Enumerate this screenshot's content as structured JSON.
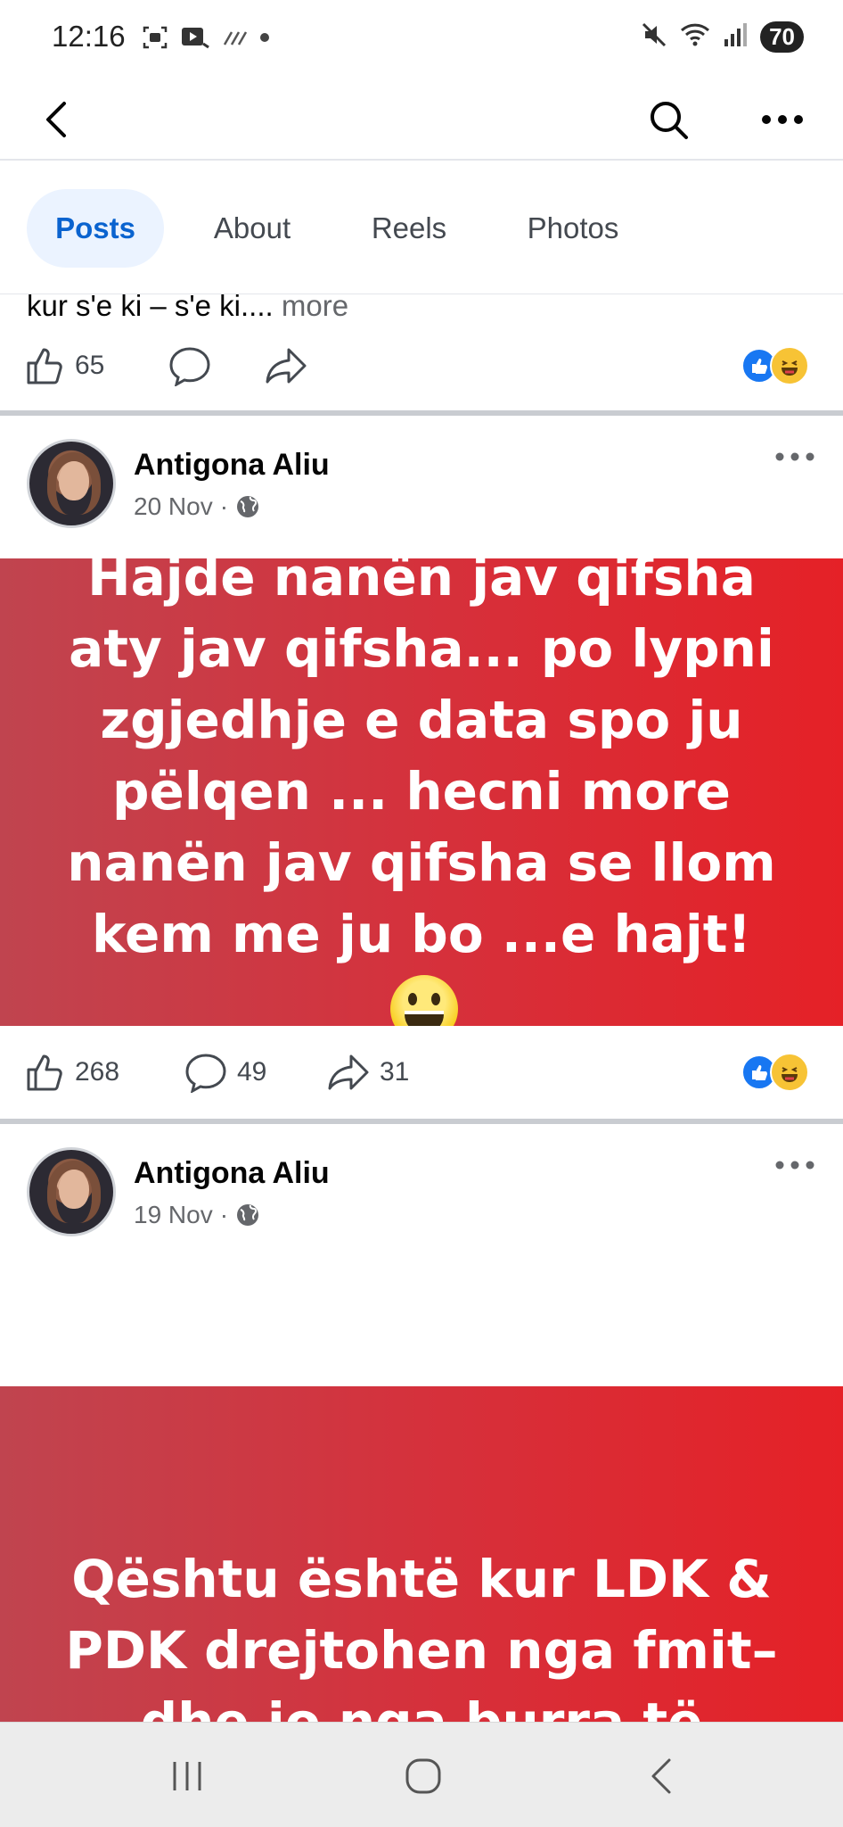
{
  "status_bar": {
    "time": "12:16",
    "battery": "70",
    "icons": [
      "screenshot-icon",
      "video-icon",
      "wifi-calling-icon",
      "dot-icon",
      "mute-icon",
      "wifi-icon",
      "signal-icon"
    ]
  },
  "app_bar": {
    "icons": [
      "back-icon",
      "search-icon",
      "more-icon"
    ]
  },
  "tabs": [
    {
      "label": "Posts",
      "active": true
    },
    {
      "label": "About",
      "active": false
    },
    {
      "label": "Reels",
      "active": false
    },
    {
      "label": "Photos",
      "active": false
    }
  ],
  "post0": {
    "truncated_text": "kur s'e ki – s'e ki....",
    "more_label": "more",
    "likes": "65"
  },
  "post1": {
    "author": "Antigona Aliu",
    "date": "20 Nov",
    "separator": "·",
    "text": "Hajde nanën jav qifsha aty jav qifsha... po lypni zgjedhje e data spo ju pëlqen ... hecni more nanën jav qifsha se llom kem me ju bo ...e hajt!",
    "likes": "268",
    "comments": "49",
    "shares": "31"
  },
  "post2": {
    "author": "Antigona Aliu",
    "date": "19 Nov",
    "separator": "·",
    "text": "Qështu është kur LDK & PDK drejtohen nga fmit– dhe jo nga burra të"
  },
  "colors": {
    "accent_blue": "#0a63cf",
    "active_tab_bg": "#ebf3ff",
    "post_bg_start": "#c0444f",
    "post_bg_end": "#e52127"
  }
}
